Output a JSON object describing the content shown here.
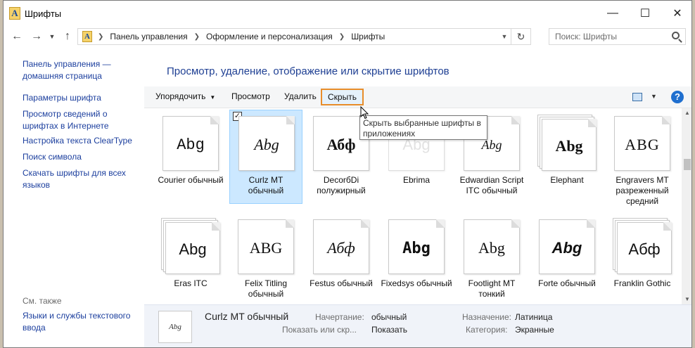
{
  "window": {
    "title": "Шрифты"
  },
  "address": {
    "breadcrumbs": [
      "Панель управления",
      "Оформление и персонализация",
      "Шрифты"
    ],
    "search_placeholder": "Поиск: Шрифты"
  },
  "sidebar": {
    "links": [
      "Панель управления — домашняя страница",
      "Параметры шрифта",
      "Просмотр сведений о шрифтах в Интернете",
      "Настройка текста ClearType",
      "Поиск символа",
      "Скачать шрифты для всех языков"
    ],
    "see_also": "См. также",
    "see_also_links": [
      "Языки и службы текстового ввода"
    ]
  },
  "main": {
    "heading": "Просмотр, удаление, отображение или скрытие шрифтов"
  },
  "toolbar": {
    "organize": "Упорядочить",
    "preview": "Просмотр",
    "delete": "Удалить",
    "hide": "Скрыть",
    "help": "?"
  },
  "tooltip": "Скрыть выбранные шрифты в приложениях",
  "fonts": [
    {
      "name": "Courier обычный",
      "sample": "Abg"
    },
    {
      "name": "Curlz MT обычный",
      "sample": "Abg"
    },
    {
      "name": "DecorбDi полужирный",
      "sample": "Абф"
    },
    {
      "name": "Ebrima",
      "sample": "Abg"
    },
    {
      "name": "Edwardian Script ITC обычный",
      "sample": "Abg"
    },
    {
      "name": "Elephant",
      "sample": "Abg"
    },
    {
      "name": "Engravers MT разреженный средний",
      "sample": "ABG"
    },
    {
      "name": "Eras ITC",
      "sample": "Abg"
    },
    {
      "name": "Felix Titling обычный",
      "sample": "ABG"
    },
    {
      "name": "Festus обычный",
      "sample": "Абф"
    },
    {
      "name": "Fixedsys обычный",
      "sample": "Abg"
    },
    {
      "name": "Footlight MT тонкий",
      "sample": "Abg"
    },
    {
      "name": "Forte обычный",
      "sample": "Abg"
    },
    {
      "name": "Franklin Gothic",
      "sample": "Абф"
    }
  ],
  "details": {
    "name": "Curlz MT обычный",
    "style_label": "Начертание:",
    "style_value": "обычный",
    "show_label": "Показать или скр...",
    "show_value": "Показать",
    "purpose_label": "Назначение:",
    "purpose_value": "Латиница",
    "category_label": "Категория:",
    "category_value": "Экранные",
    "thumb_sample": "Abg"
  }
}
